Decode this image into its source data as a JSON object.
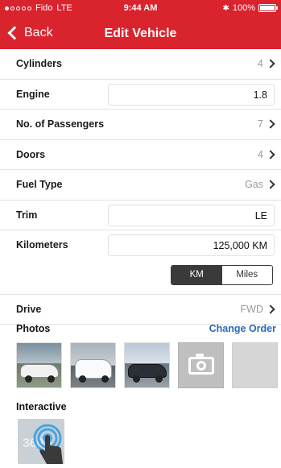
{
  "status_bar": {
    "carrier": "Fido",
    "network": "LTE",
    "time": "9:44 AM",
    "battery": "100%"
  },
  "nav": {
    "back_label": "Back",
    "title": "Edit Vehicle"
  },
  "fields": {
    "cylinders": {
      "label": "Cylinders",
      "value": "4"
    },
    "engine": {
      "label": "Engine",
      "value": "1.8"
    },
    "passengers": {
      "label": "No. of Passengers",
      "value": "7"
    },
    "doors": {
      "label": "Doors",
      "value": "4"
    },
    "fuel_type": {
      "label": "Fuel Type",
      "value": "Gas"
    },
    "trim": {
      "label": "Trim",
      "value": "LE"
    },
    "kilometers": {
      "label": "Kilometers",
      "value": "125,000 KM"
    },
    "drive": {
      "label": "Drive",
      "value": "FWD"
    }
  },
  "units": {
    "options": [
      "KM",
      "Miles"
    ],
    "selected": "KM"
  },
  "photos": {
    "label": "Photos",
    "change_order": "Change Order"
  },
  "interactive": {
    "label": "Interactive",
    "badge": "360"
  },
  "colors": {
    "header": "#d9232d",
    "link": "#2a6ab5",
    "segment_active": "#3a3a3a"
  },
  "icons": {
    "back": "chevron-left-icon",
    "row_arrow": "chevron-right-icon",
    "camera": "camera-icon",
    "interactive": "360-touch-icon"
  }
}
